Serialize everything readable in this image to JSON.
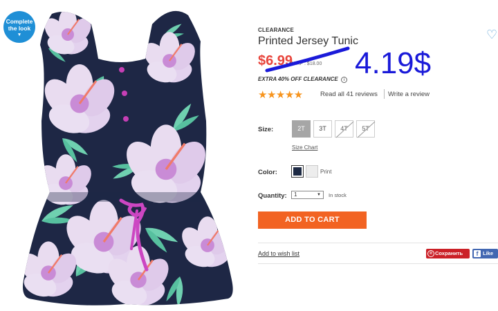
{
  "complete_look": {
    "line1": "Complete",
    "line2": "the look",
    "caret": "▾"
  },
  "product": {
    "badge": "CLEARANCE",
    "title": "Printed Jersey Tunic",
    "sale_price": "$6.99",
    "msrp": "MSRP : $18.00",
    "handwritten_price": "4.19$",
    "promo": "EXTRA 40% OFF CLEARANCE",
    "promo_info_icon": "i"
  },
  "reviews": {
    "rating": 5,
    "max_rating": 5,
    "stars": "★★★★★",
    "read_label": "Read all 41 reviews",
    "write_label": "Write a review"
  },
  "size": {
    "label": "Size:",
    "options": [
      "2T",
      "3T",
      "4T",
      "5T"
    ],
    "selected": "2T",
    "unavailable": [
      "4T",
      "5T"
    ],
    "chart_link": "Size Chart"
  },
  "color": {
    "label": "Color:",
    "selected_name": "Print",
    "swatches": {
      "navy": "#1d2a44",
      "print": "#ededed"
    }
  },
  "quantity": {
    "label": "Quantity:",
    "value": "1",
    "arrow": "▼",
    "stock_status": "In stock"
  },
  "actions": {
    "add_to_cart": "ADD TO CART",
    "wish_list": "Add to wish list",
    "pin_label": "Сохранить",
    "pin_icon": "℗",
    "fb_label": "Like",
    "fb_icon": "f",
    "heart": "♡"
  },
  "colors": {
    "accent": "#f26322",
    "sale": "#e8453c",
    "badge": "#1f8fd6",
    "handwriting": "#1a1ad9"
  }
}
